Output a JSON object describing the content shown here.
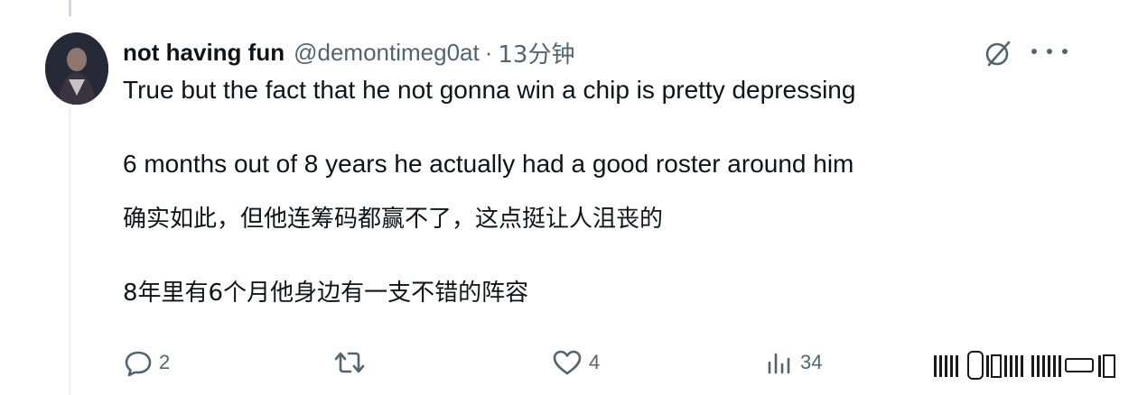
{
  "tweet": {
    "display_name": "not having fun",
    "handle": "@demontimeg0at",
    "separator": "·",
    "time": "13分钟",
    "text_lines": [
      "True but the fact that he not gonna win a chip is pretty depressing",
      "6 months out of 8 years he actually had a good roster around him",
      "确实如此，但他连筹码都赢不了，这点挺让人沮丧的",
      "8年里有6个月他身边有一支不错的阵容"
    ]
  },
  "actions": {
    "reply_count": "2",
    "retweet_count": "",
    "like_count": "4",
    "view_count": "34"
  },
  "icons": {
    "reply": "reply-icon",
    "retweet": "retweet-icon",
    "like": "heart-icon",
    "views": "views-icon",
    "grok": "grok-icon",
    "more": "more-icon"
  },
  "colors": {
    "text": "#0f1419",
    "secondary": "#536471",
    "thread_line": "#cfd9de"
  }
}
